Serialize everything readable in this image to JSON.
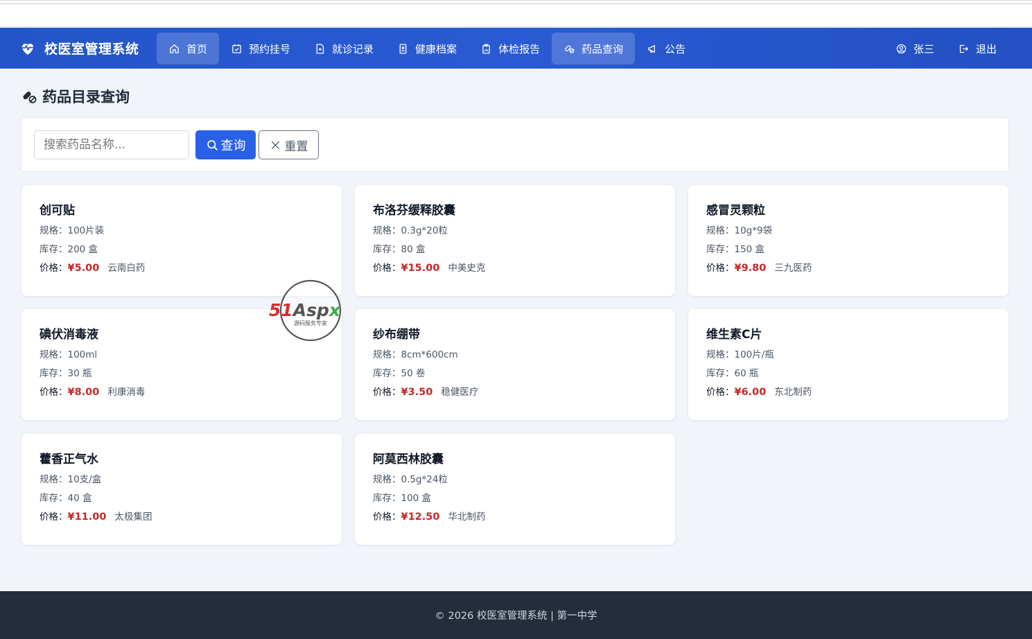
{
  "brand": {
    "title": "校医室管理系统",
    "icon": "heart-pulse-icon"
  },
  "nav": {
    "items": [
      {
        "label": "首页",
        "icon": "home-icon",
        "active": true
      },
      {
        "label": "预约挂号",
        "icon": "calendar-check-icon",
        "active": false
      },
      {
        "label": "就诊记录",
        "icon": "file-medical-icon",
        "active": false
      },
      {
        "label": "健康档案",
        "icon": "file-person-icon",
        "active": false
      },
      {
        "label": "体检报告",
        "icon": "clipboard-icon",
        "active": false
      },
      {
        "label": "药品查询",
        "icon": "capsule-icon",
        "active": true
      },
      {
        "label": "公告",
        "icon": "megaphone-icon",
        "active": false
      }
    ],
    "user": {
      "label": "张三",
      "icon": "user-circle-icon"
    },
    "logout": {
      "label": "退出",
      "icon": "logout-icon"
    }
  },
  "page": {
    "title": "药品目录查询",
    "icon": "capsule-icon"
  },
  "search": {
    "placeholder": "搜索药品名称...",
    "value": "",
    "search_label": "查询",
    "reset_label": "重置"
  },
  "labels": {
    "spec": "规格：",
    "stock": "库存：",
    "price": "价格："
  },
  "drugs": [
    {
      "name": "创可贴",
      "spec": "100片装",
      "stock": "200 盒",
      "price": "¥5.00",
      "maker": "云南白药"
    },
    {
      "name": "布洛芬缓释胶囊",
      "spec": "0.3g*20粒",
      "stock": "80 盒",
      "price": "¥15.00",
      "maker": "中美史克"
    },
    {
      "name": "感冒灵颗粒",
      "spec": "10g*9袋",
      "stock": "150 盒",
      "price": "¥9.80",
      "maker": "三九医药"
    },
    {
      "name": "碘伏消毒液",
      "spec": "100ml",
      "stock": "30 瓶",
      "price": "¥8.00",
      "maker": "利康消毒"
    },
    {
      "name": "纱布绷带",
      "spec": "8cm*600cm",
      "stock": "50 卷",
      "price": "¥3.50",
      "maker": "稳健医疗"
    },
    {
      "name": "维生素C片",
      "spec": "100片/瓶",
      "stock": "60 瓶",
      "price": "¥6.00",
      "maker": "东北制药"
    },
    {
      "name": "藿香正气水",
      "spec": "10支/盒",
      "stock": "40 盒",
      "price": "¥11.00",
      "maker": "太极集团"
    },
    {
      "name": "阿莫西林胶囊",
      "spec": "0.5g*24粒",
      "stock": "100 盒",
      "price": "¥12.50",
      "maker": "华北制药"
    }
  ],
  "watermark": {
    "main": "51Aspx",
    "sub": "源码服务专家"
  },
  "footer": {
    "text": "© 2026 校医室管理系统 | 第一中学"
  },
  "colors": {
    "nav": "#2a5ad3",
    "primary": "#2a60e8",
    "price": "#c62828",
    "footer": "#242d3b",
    "background": "#f1f4f9"
  }
}
